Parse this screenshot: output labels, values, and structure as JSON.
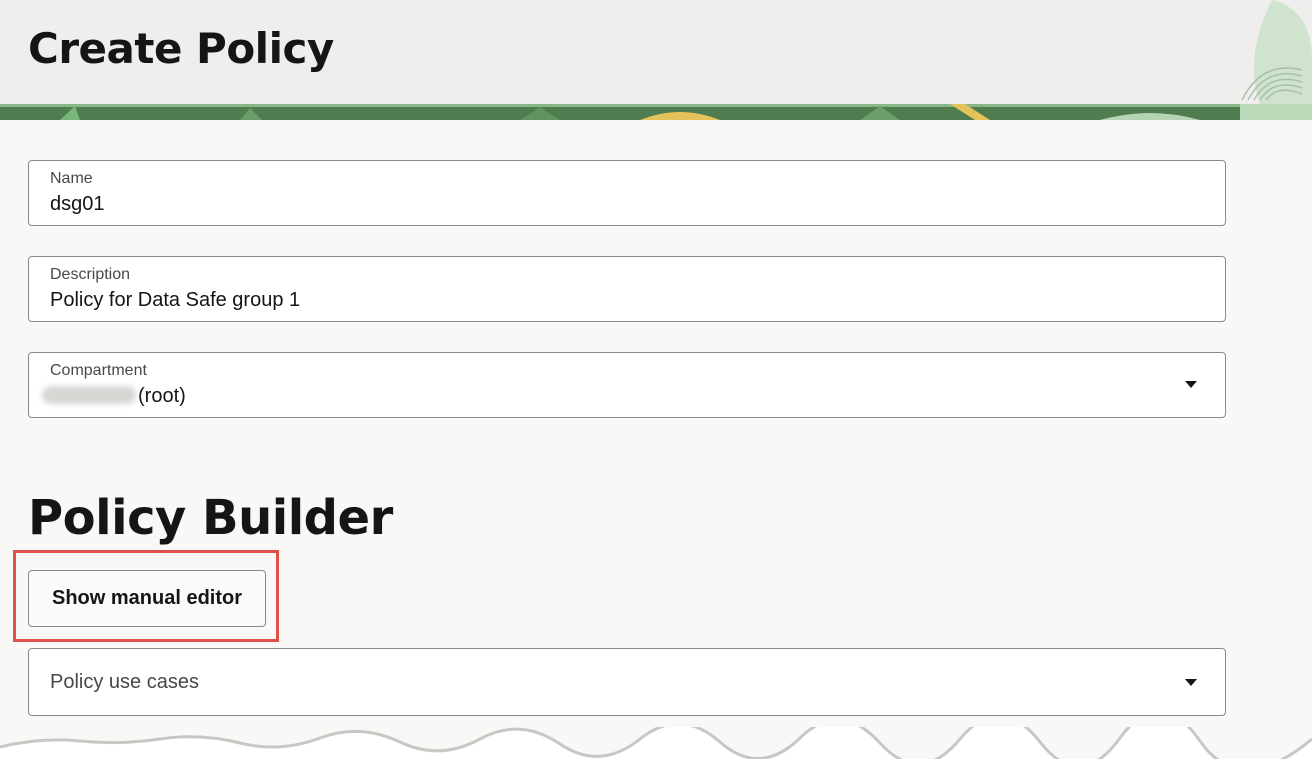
{
  "header": {
    "title": "Create Policy"
  },
  "form": {
    "name": {
      "label": "Name",
      "value": "dsg01"
    },
    "description": {
      "label": "Description",
      "value": "Policy for Data Safe group 1"
    },
    "compartment": {
      "label": "Compartment",
      "value_suffix": "(root)"
    }
  },
  "policy_builder": {
    "title": "Policy Builder",
    "show_manual_editor_label": "Show manual editor",
    "use_cases_placeholder": "Policy use cases"
  },
  "colors": {
    "highlight": "#e2504b",
    "banner_green": "#4f7d4f",
    "banner_yellow": "#e6c25a"
  },
  "icons": [
    "chevron-down-icon"
  ]
}
